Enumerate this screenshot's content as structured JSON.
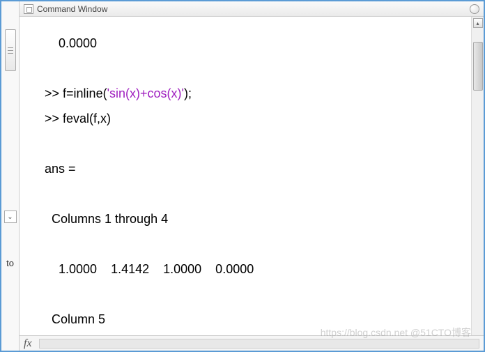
{
  "window": {
    "title": "Command Window"
  },
  "sidebar": {
    "text": "to"
  },
  "output": {
    "line1": "    0.0000",
    "prompt1": ">> ",
    "cmd1_pre": "f=inline(",
    "cmd1_str": "'sin(x)+cos(x)'",
    "cmd1_post": ");",
    "prompt2": ">> ",
    "cmd2": "feval(f,x)",
    "ans_label": "ans =",
    "cols_header": "  Columns 1 through 4",
    "values_row": "    1.0000    1.4142    1.0000    0.0000",
    "col5_header": "  Column 5"
  },
  "bottom": {
    "fx": "fx"
  },
  "watermark": "https://blog.csdn.net @51CTO博客"
}
